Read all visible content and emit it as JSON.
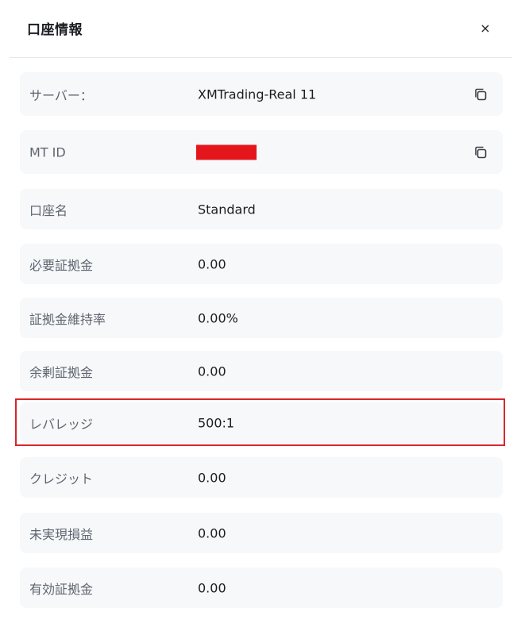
{
  "dialog": {
    "title": "口座情報",
    "close_label": "×"
  },
  "rows": [
    {
      "label": "サーバー：",
      "value": "XMTrading-Real 11",
      "copyable": true
    },
    {
      "label": "MT ID",
      "value": "",
      "redacted": true,
      "copyable": true
    },
    {
      "label": "口座名",
      "value": "Standard"
    },
    {
      "label": "必要証拠金",
      "value": "0.00"
    },
    {
      "label": "証拠金維持率",
      "value": "0.00%"
    },
    {
      "label": "余剰証拠金",
      "value": "0.00"
    },
    {
      "label": "レバレッジ",
      "value": "500:1",
      "highlighted": true
    },
    {
      "label": "クレジット",
      "value": "0.00"
    },
    {
      "label": "未実現損益",
      "value": "0.00"
    },
    {
      "label": "有効証拠金",
      "value": "0.00"
    }
  ],
  "icons": {
    "copy": "copy-icon",
    "close": "close-icon"
  },
  "colors": {
    "row_background": "#f7f8fa",
    "label_text": "#5f6670",
    "value_text": "#1a1d21",
    "redaction": "#e4161c",
    "highlight_border": "#d9262c"
  }
}
